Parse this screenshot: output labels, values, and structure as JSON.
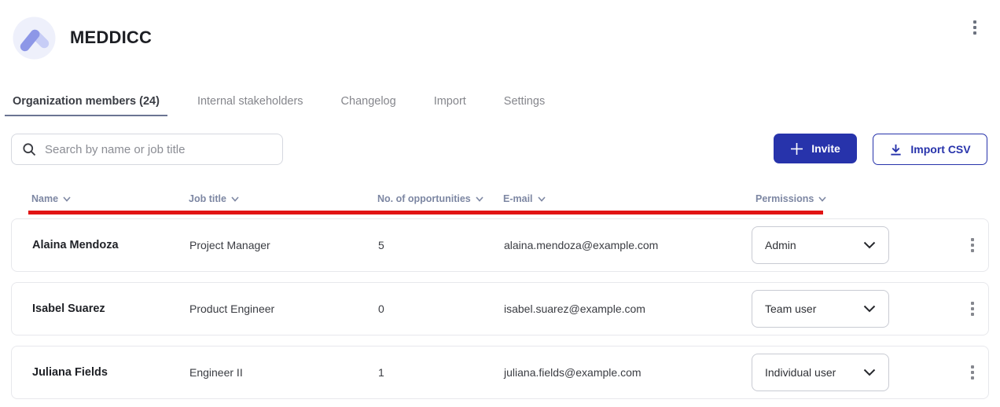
{
  "header": {
    "app_title": "MEDDICC"
  },
  "tabs": [
    {
      "label": "Organization members (24)",
      "active": true
    },
    {
      "label": "Internal stakeholders",
      "active": false
    },
    {
      "label": "Changelog",
      "active": false
    },
    {
      "label": "Import",
      "active": false
    },
    {
      "label": "Settings",
      "active": false
    }
  ],
  "toolbar": {
    "search_placeholder": "Search by name or job title",
    "invite_label": "Invite",
    "import_csv_label": "Import CSV"
  },
  "table": {
    "columns": [
      {
        "label": "Name"
      },
      {
        "label": "Job title"
      },
      {
        "label": "No. of opportunities"
      },
      {
        "label": "E-mail"
      },
      {
        "label": "Permissions"
      }
    ],
    "rows": [
      {
        "name": "Alaina Mendoza",
        "job_title": "Project Manager",
        "opportunities": "5",
        "email": "alaina.mendoza@example.com",
        "permission": "Admin"
      },
      {
        "name": "Isabel Suarez",
        "job_title": "Product Engineer",
        "opportunities": "0",
        "email": "isabel.suarez@example.com",
        "permission": "Team user"
      },
      {
        "name": "Juliana Fields",
        "job_title": "Engineer II",
        "opportunities": "1",
        "email": "juliana.fields@example.com",
        "permission": "Individual user"
      }
    ]
  },
  "icons": {
    "logo": "chevron-mountain-icon",
    "page_menu": "kebab-icon",
    "search": "search-icon",
    "invite": "plus-icon",
    "import": "download-icon",
    "column_sort": "chevron-down-icon",
    "permissions": "chevron-down-icon",
    "row_menu": "kebab-icon"
  },
  "colors": {
    "primary_blue": "#2733ab",
    "annotation_red": "#e11414",
    "active_tab_underline": "#6b7492",
    "column_header_text": "#7d87a3",
    "logo_background": "#eef0fb",
    "logo_chevron_dark": "#8d97e7",
    "logo_chevron_light": "#c7cdf6"
  }
}
